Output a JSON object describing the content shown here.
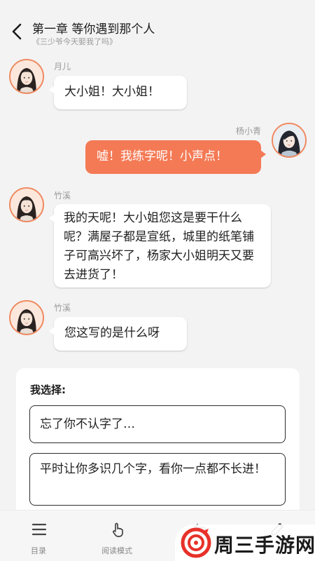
{
  "header": {
    "title": "第一章 等你遇到那个人",
    "subtitle": "《三少爷今天娶我了吗》"
  },
  "messages": [
    {
      "sender": "月儿",
      "text": "大小姐！大小姐！",
      "side": "left"
    },
    {
      "sender": "杨小青",
      "text": "嘘！我练字呢！小声点！",
      "side": "right"
    },
    {
      "sender": "竹溪",
      "text": "我的天呢！大小姐您这是要干什么呢？满屋子都是宣纸，城里的纸笔铺子可高兴坏了，杨家大小姐明天又要去进货了！",
      "side": "left"
    },
    {
      "sender": "竹溪",
      "text": "您这写的是什么呀",
      "side": "left"
    }
  ],
  "choices": {
    "title": "我选择:",
    "options": [
      "忘了你不认字了…",
      "平时让你多识几个字，看你一点都不长进！"
    ]
  },
  "bottom_nav": [
    {
      "label": "目录",
      "icon": "menu-icon"
    },
    {
      "label": "阅读模式",
      "icon": "tap-hand-icon"
    },
    {
      "label": "",
      "icon": "undo-icon"
    },
    {
      "label": "",
      "icon": "edit-icon"
    }
  ],
  "watermark": {
    "text": "周三手游网"
  },
  "colors": {
    "accent": "#f47a55",
    "avatar_border": "#f0895f",
    "background": "#f3f3f3"
  }
}
